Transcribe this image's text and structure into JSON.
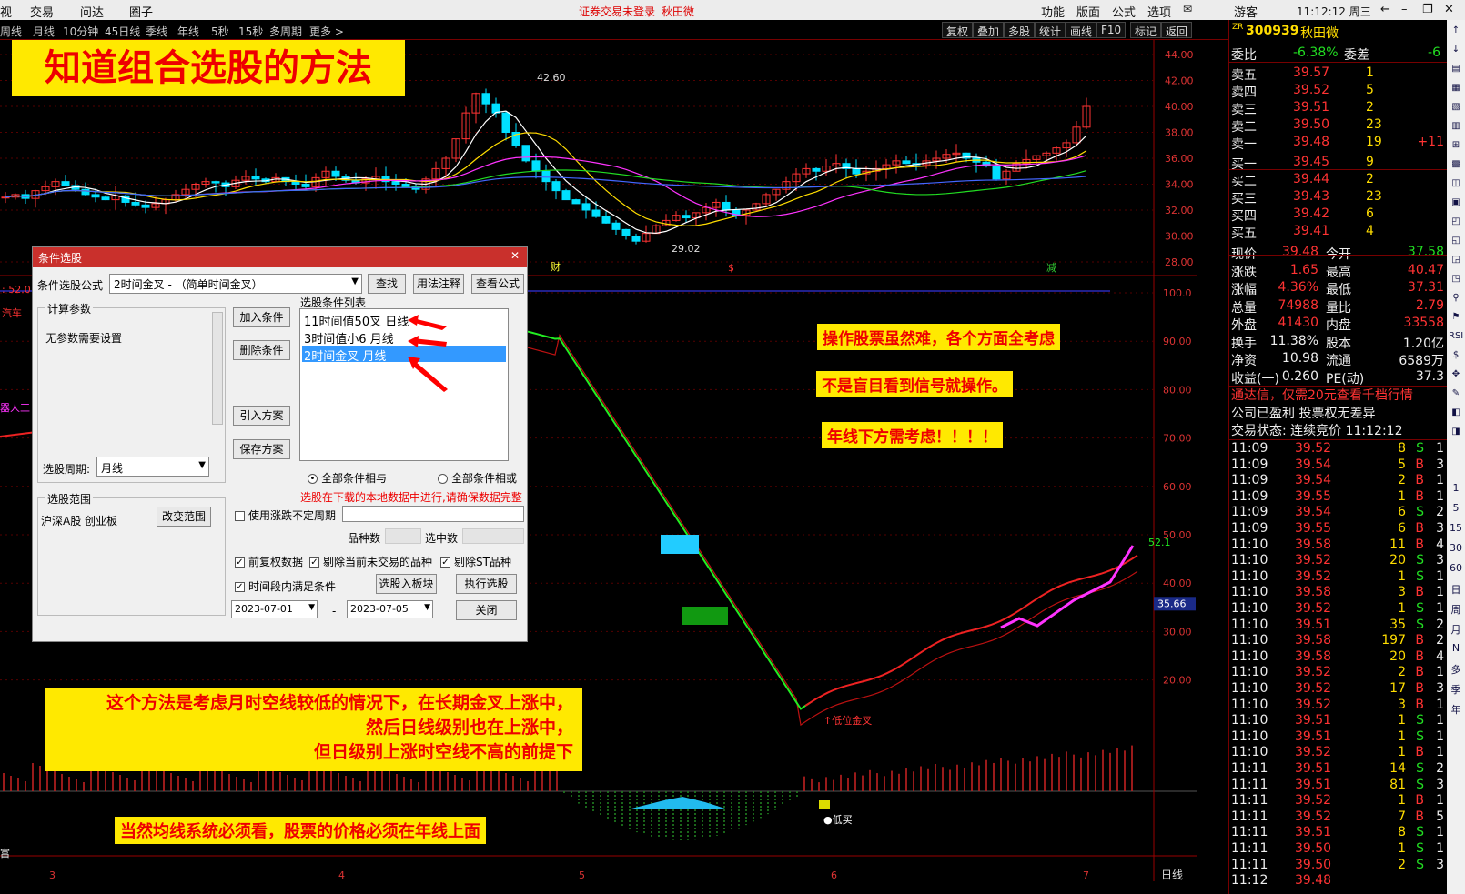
{
  "menu": {
    "items": [
      "视",
      "交易",
      "问达",
      "圈子"
    ],
    "warn": "证券交易未登录",
    "user": "秋田微",
    "right_items": [
      "功能",
      "版面",
      "公式",
      "选项"
    ],
    "guest": "游客",
    "clock": "11:12:12 周三"
  },
  "periods": [
    "周线",
    "月线",
    "10分钟",
    "45日线",
    "季线",
    "年线",
    "5秒",
    "15秒",
    "多周期",
    "更多 >"
  ],
  "toolbar_right": [
    "复权",
    "叠加",
    "多股",
    "统计",
    "画线",
    "F10",
    "标记",
    "返回"
  ],
  "banner": "知道组合选股的方法",
  "price_axis": [
    "44.00",
    "42.00",
    "40.00",
    "38.00",
    "36.00",
    "34.00",
    "32.00",
    "30.00",
    "28.00"
  ],
  "osc_axis": [
    "100.0",
    "90.00",
    "80.00",
    "70.00",
    "60.00",
    "50.00",
    "40.00",
    "30.00",
    "20.00"
  ],
  "osc_marker": "35.66",
  "price_labels": {
    "high": "42.60",
    "low": "29.02",
    "last_osc": "52.1"
  },
  "osc_cross_label": "↑低位金叉",
  "macd_label": "●低买",
  "x_axis": [
    "3",
    "4",
    "5",
    "6",
    "7"
  ],
  "x_axis_right": "日线",
  "events": [
    "财",
    "$",
    "减"
  ],
  "left_labels": {
    "osc_top": ": 52.0",
    "industry": "汽车",
    "robot": "器人工",
    "bottom": "富"
  },
  "annotations": {
    "a1": "操作股票虽然难，各个方面全考虑",
    "a2": "不是盲目看到信号就操作。",
    "a3": "年线下方需考虑！！！！",
    "note1": [
      "这个方法是考虑月时空线较低的情况下，在长期金叉上涨中，",
      "然后日线级别也在上涨中，",
      "但日级别上涨时空线不高的前提下"
    ],
    "note2": "当然均线系统必须看，股票的价格必须在年线上面"
  },
  "dialog": {
    "title": "条件选股",
    "formula_label": "条件选股公式",
    "formula_value": "2时间金叉  - （简单时间金叉）",
    "find": "查找",
    "usage": "用法注释",
    "view": "查看公式",
    "calc_group": "计算参数",
    "no_param": "无参数需要设置",
    "add": "加入条件",
    "del": "删除条件",
    "import": "引入方案",
    "save": "保存方案",
    "list_label": "选股条件列表",
    "conditions": [
      "11时间值50叉  日线",
      "3时间值小6  月线",
      "2时间金叉  月线"
    ],
    "and_all": "全部条件相与",
    "or_all": "全部条件相或",
    "period_label": "选股周期:",
    "period_value": "月线",
    "range_group": "选股范围",
    "range_value": "沪深A股 创业板",
    "change_range": "改变范围",
    "warning": "选股在下载的本地数据中进行,请确保数据完整",
    "use_zd": "使用涨跌不定周期",
    "count_label": "品种数",
    "selected_label": "选中数",
    "opt1": "前复权数据",
    "opt2": "剔除当前未交易的品种",
    "opt3": "剔除ST品种",
    "opt4": "时间段内满足条件",
    "to_block": "选股入板块",
    "run": "执行选股",
    "date_from": "2023-07-01",
    "date_to": "2023-07-05",
    "close": "关闭"
  },
  "quote": {
    "code": "300939",
    "name": "秋田微",
    "zr": "ZR",
    "wb_label": "委比",
    "wb": "-6.38%",
    "wc_label": "委差",
    "wc": "-6",
    "sells": [
      {
        "l": "卖五",
        "p": "39.57",
        "v": "1"
      },
      {
        "l": "卖四",
        "p": "39.52",
        "v": "5"
      },
      {
        "l": "卖三",
        "p": "39.51",
        "v": "2"
      },
      {
        "l": "卖二",
        "p": "39.50",
        "v": "23"
      },
      {
        "l": "卖一",
        "p": "39.48",
        "v": "19",
        "x": "+11"
      }
    ],
    "buys": [
      {
        "l": "买一",
        "p": "39.45",
        "v": "9"
      },
      {
        "l": "买二",
        "p": "39.44",
        "v": "2"
      },
      {
        "l": "买三",
        "p": "39.43",
        "v": "23"
      },
      {
        "l": "买四",
        "p": "39.42",
        "v": "6"
      },
      {
        "l": "买五",
        "p": "39.41",
        "v": "4"
      }
    ],
    "stats": [
      [
        "现价",
        "39.48",
        "今开",
        "37.58"
      ],
      [
        "涨跌",
        "1.65",
        "最高",
        "40.47"
      ],
      [
        "涨幅",
        "4.36%",
        "最低",
        "37.31"
      ],
      [
        "总量",
        "74988",
        "量比",
        "2.79"
      ],
      [
        "外盘",
        "41430",
        "内盘",
        "33558"
      ],
      [
        "换手",
        "11.38%",
        "股本",
        "1.20亿"
      ],
      [
        "净资",
        "10.98",
        "流通",
        "6589万"
      ],
      [
        "收益(一)",
        "0.260",
        "PE(动)",
        "37.3"
      ]
    ],
    "ad1": "通达信，仅需20元查看千档行情",
    "ad2": "公司已盈利 投票权无差异",
    "trade_status": "交易状态: 连续竞价 11:12:12",
    "ticks": [
      [
        "11:09",
        "39.52",
        "8",
        "S",
        "1"
      ],
      [
        "11:09",
        "39.54",
        "5",
        "B",
        "3"
      ],
      [
        "11:09",
        "39.54",
        "2",
        "B",
        "1"
      ],
      [
        "11:09",
        "39.55",
        "1",
        "B",
        "1"
      ],
      [
        "11:09",
        "39.54",
        "6",
        "S",
        "2"
      ],
      [
        "11:09",
        "39.55",
        "6",
        "B",
        "3"
      ],
      [
        "11:10",
        "39.58",
        "11",
        "B",
        "4"
      ],
      [
        "11:10",
        "39.52",
        "20",
        "S",
        "3"
      ],
      [
        "11:10",
        "39.52",
        "1",
        "S",
        "1"
      ],
      [
        "11:10",
        "39.58",
        "3",
        "B",
        "1"
      ],
      [
        "11:10",
        "39.52",
        "1",
        "S",
        "1"
      ],
      [
        "11:10",
        "39.51",
        "35",
        "S",
        "2"
      ],
      [
        "11:10",
        "39.58",
        "197",
        "B",
        "2"
      ],
      [
        "11:10",
        "39.58",
        "20",
        "B",
        "4"
      ],
      [
        "11:10",
        "39.52",
        "2",
        "B",
        "1"
      ],
      [
        "11:10",
        "39.52",
        "17",
        "B",
        "3"
      ],
      [
        "11:10",
        "39.52",
        "3",
        "B",
        "1"
      ],
      [
        "11:10",
        "39.51",
        "1",
        "S",
        "1"
      ],
      [
        "11:10",
        "39.51",
        "1",
        "S",
        "1"
      ],
      [
        "11:10",
        "39.52",
        "1",
        "B",
        "1"
      ],
      [
        "11:11",
        "39.51",
        "14",
        "S",
        "2"
      ],
      [
        "11:11",
        "39.51",
        "81",
        "S",
        "3"
      ],
      [
        "11:11",
        "39.52",
        "1",
        "B",
        "1"
      ],
      [
        "11:11",
        "39.52",
        "7",
        "B",
        "5"
      ],
      [
        "11:11",
        "39.51",
        "8",
        "S",
        "1"
      ],
      [
        "11:11",
        "39.50",
        "1",
        "S",
        "1"
      ],
      [
        "11:11",
        "39.50",
        "2",
        "S",
        "3"
      ],
      [
        "11:12",
        "39.48",
        "",
        "",
        ""
      ]
    ]
  },
  "sidebar": [
    "1",
    "5",
    "15",
    "30",
    "60",
    "日",
    "周",
    "月",
    "N",
    "多",
    "季",
    "年"
  ]
}
